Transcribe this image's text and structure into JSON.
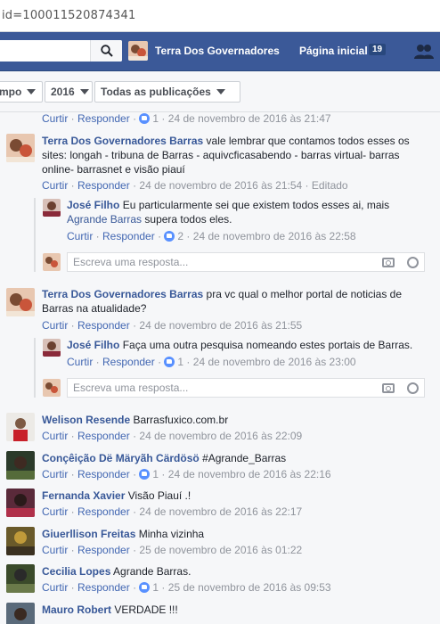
{
  "browser": {
    "url": "id=100011520874341"
  },
  "topbar": {
    "page_name": "Terra Dos Governadores",
    "home_label": "Página inicial",
    "home_count": "19"
  },
  "filters": {
    "first": "mpo",
    "year": "2016",
    "posts": "Todas as publicações"
  },
  "labels": {
    "like": "Curtir",
    "reply": "Responder",
    "write_placeholder": "Escreva uma resposta..."
  },
  "comments": [
    {
      "likes": "1",
      "time": "24 de novembro de 2016 às 21:47"
    },
    {
      "author": "Terra Dos Governadores Barras",
      "text": "vale lembrar que contamos todos esses os sites: longah - tribuna de Barras - aquivcficasabendo - barras virtual- barras online- barrasnet e visão piauí",
      "time": "24 de novembro de 2016 às 21:54",
      "edited": "Editado"
    },
    {
      "author": "José Filho",
      "text": "Eu particularmente sei que existem todos esses ai, mais",
      "mention": "Agrande Barras",
      "text2": "supera todos eles.",
      "likes": "2",
      "time": "24 de novembro de 2016 às 22:58"
    },
    {
      "author": "Terra Dos Governadores Barras",
      "text": "pra vc qual o melhor portal de noticias de Barras na atualidade?",
      "time": "24 de novembro de 2016 às 21:55"
    },
    {
      "author": "José Filho",
      "text": "Faça uma outra pesquisa nomeando estes portais de Barras.",
      "likes": "1",
      "time": "24 de novembro de 2016 às 23:00"
    },
    {
      "author": "Welison Resende",
      "text": "Barrasfuxico.com.br",
      "time": "24 de novembro de 2016 às 22:09"
    },
    {
      "author": "Conçêição Dë Märyãh Cärdösö",
      "text": "#Agrande_Barras",
      "likes": "1",
      "time": "24 de novembro de 2016 às 22:16"
    },
    {
      "author": "Fernanda Xavier",
      "text": "Visão Piauí .!",
      "time": "24 de novembro de 2016 às 22:17"
    },
    {
      "author": "Giuerllison Freitas",
      "text": "Minha vizinha",
      "time": "25 de novembro de 2016 às 01:22"
    },
    {
      "author": "Cecilia Lopes",
      "text": "Agrande Barras.",
      "likes": "1",
      "time": "25 de novembro de 2016 às 09:53"
    },
    {
      "author": "Mauro Robert",
      "text": "VERDADE !!!"
    }
  ],
  "colors": {
    "fb_blue": "#3b5998",
    "link": "#385898",
    "like_blue": "#5890ff"
  }
}
